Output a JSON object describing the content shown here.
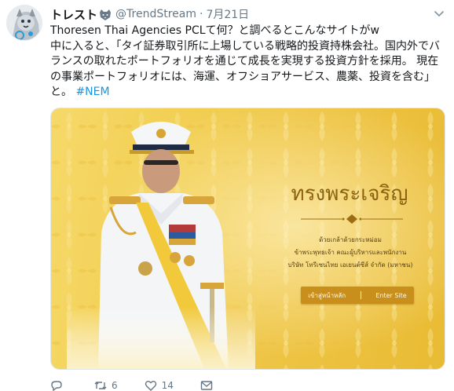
{
  "tweet": {
    "display_name": "トレスト",
    "handle": "@TrendStream",
    "separator": "·",
    "date": "7月21日",
    "text_lines": [
      "Thoresen Thai Agencies PCLて何？と調べるとこんなサイトがw",
      "中に入ると、「タイ証券取引所に上場している戦略的投資持株会社。国内外でバ",
      "ランスの取れたポートフォリオを通じて成長を実現する投資方針を採用。 現在",
      "の事業ポートフォリオには、海運、オフショアサービス、農薬、投資を含む」"
    ],
    "last_line_text": "と。",
    "hashtag": "#NEM"
  },
  "media": {
    "thai_title": "ทรงพระเจริญ",
    "thai_lines": [
      "ด้วยเกล้าด้วยกระหม่อม",
      "ข้าพระพุทธเจ้า คณะผู้บริหารและพนักงาน",
      "บริษัท โทรีเซนไทย เอเยนต์ซีส์ จำกัด (มหาชน)"
    ],
    "enter_thai": "เข้าสู่หน้าหลัก",
    "enter_en": "Enter Site"
  },
  "actions": {
    "reply_count": "",
    "retweet_count": "6",
    "like_count": "14"
  },
  "colors": {
    "link": "#1b95e0",
    "muted": "#657786",
    "gold": "#eec444"
  },
  "icons": [
    "avatar",
    "wolf-icon",
    "chevron-down-icon",
    "reply-icon",
    "retweet-icon",
    "like-icon",
    "message-icon"
  ]
}
